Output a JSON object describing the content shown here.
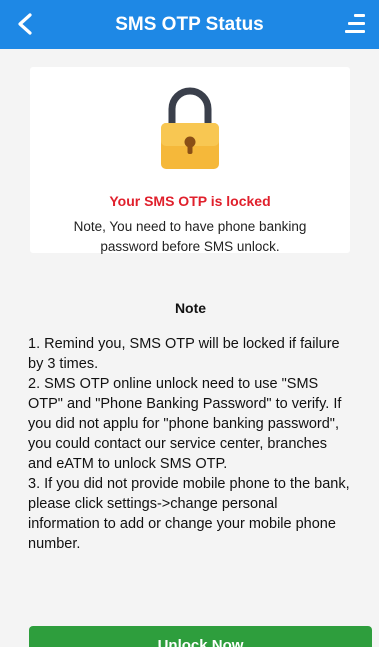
{
  "header": {
    "title": "SMS OTP Status",
    "back_icon": "chevron-left-icon",
    "menu_icon": "menu-icon",
    "background_color": "#1e88e5"
  },
  "lock_card": {
    "icon": "padlock-icon",
    "status": "Your SMS OTP is locked",
    "status_color": "#e0202c",
    "note": "Note, You need to have phone banking password before SMS unlock."
  },
  "notes": {
    "title": "Note",
    "items": [
      "1. Remind you, SMS OTP will be locked if failure by 3 times.",
      "2. SMS OTP online unlock need to use \"SMS OTP\" and \"Phone Banking Password\" to verify. If you did not applu for \"phone banking password\", you could contact our service center, branches and eATM to unlock SMS OTP.",
      "3. If you did not provide mobile phone to the bank, please click settings->change personal information to add or change your mobile phone number."
    ]
  },
  "unlock_button": {
    "label": "Unlock Now",
    "color": "#2e9e3d"
  }
}
